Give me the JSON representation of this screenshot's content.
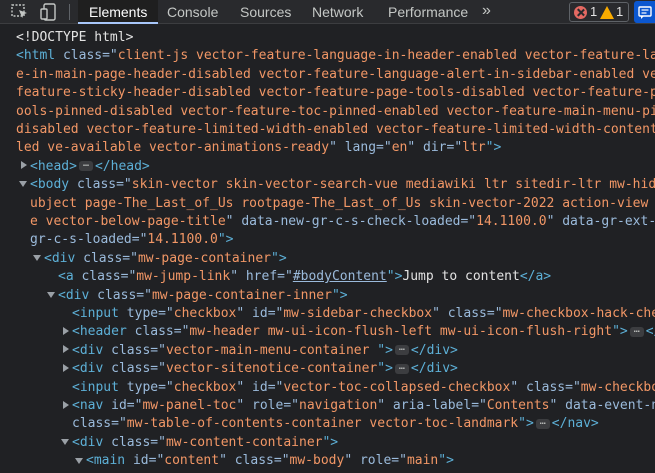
{
  "toolbar": {
    "tabs": [
      "Elements",
      "Console",
      "Sources",
      "Network",
      "Performance"
    ],
    "more_label": "»",
    "error_count": "1",
    "warning_count": "1"
  },
  "tree": {
    "doctype": "<!DOCTYPE html>",
    "html_l1a": "<html",
    "html_l1b": " class=\"",
    "html_l1c": "client-js vector-feature-language-in-header-enabled vector-feature-languag",
    "html_l2": "e-in-main-page-header-disabled vector-feature-language-alert-in-sidebar-enabled vector-",
    "html_l3": "feature-sticky-header-disabled vector-feature-page-tools-disabled vector-feature-page-t",
    "html_l4": "ools-pinned-disabled vector-feature-toc-pinned-enabled vector-feature-main-menu-pinned-",
    "html_l5": "disabled vector-feature-limited-width-enabled vector-feature-limited-width-content-enab",
    "html_l6a": "led ve-available vector-animations-ready",
    "html_l6b": "\" lang=\"",
    "html_l6c": "en",
    "html_l6d": "\" dir=\"",
    "html_l6e": "ltr",
    "html_l6f": "\">",
    "head_open": "<head>",
    "head_close": "</head>",
    "body_l1a": "<body",
    "body_l1b": " class=\"",
    "body_l1c": "skin-vector skin-vector-search-vue mediawiki ltr sitedir-ltr mw-hide-empt",
    "body_l2": "ubject page-The_Last_of_Us rootpage-The_Last_of_Us skin-vector-2022 action-view uls-di",
    "body_l3a": "e vector-below-page-title",
    "body_l3b": "\" data-new-gr-c-s-check-loaded=\"",
    "body_l3c": "14.1100.0",
    "body_l3d": "\" data-gr-ext-instal",
    "body_l4a": "gr-c-s-loaded=\"",
    "body_l4b": "14.1100.0",
    "body_l4c": "\">",
    "pc_a": "<div",
    "pc_b": " class=\"",
    "pc_c": "mw-page-container",
    "pc_d": "\">",
    "jump_a": "<a",
    "jump_b": " class=\"",
    "jump_c": "mw-jump-link",
    "jump_d": "\" href=\"",
    "jump_e": "#bodyContent",
    "jump_f": "\">",
    "jump_g": "Jump to content",
    "jump_h": "</a>",
    "pci_a": "<div",
    "pci_b": " class=\"",
    "pci_c": "mw-page-container-inner",
    "pci_d": "\">",
    "in1_a": "<input",
    "in1_b": " type=\"",
    "in1_c": "checkbox",
    "in1_d": "\" id=\"",
    "in1_e": "mw-sidebar-checkbox",
    "in1_f": "\" class=\"",
    "in1_g": "mw-checkbox-hack-checkbox",
    "hdr_a": "<header",
    "hdr_b": " class=\"",
    "hdr_c": "mw-header mw-ui-icon-flush-left mw-ui-icon-flush-right",
    "hdr_d": "\">",
    "hdr_e": "</heade",
    "mm_a": "<div",
    "mm_b": " class=\"",
    "mm_c": "vector-main-menu-container ",
    "mm_d": "\">",
    "mm_e": "</div>",
    "sn_a": "<div",
    "sn_b": " class=\"",
    "sn_c": "vector-sitenotice-container",
    "sn_d": "\">",
    "sn_e": "</div>",
    "in2_a": "<input",
    "in2_b": " type=\"",
    "in2_c": "checkbox",
    "in2_d": "\" id=\"",
    "in2_e": "vector-toc-collapsed-checkbox",
    "in2_f": "\" class=\"",
    "in2_g": "mw-checkbox-hack",
    "nav_a": "<nav",
    "nav_b": " id=\"",
    "nav_c": "mw-panel-toc",
    "nav_d": "\" role=\"",
    "nav_e": "navigation",
    "nav_f": "\" aria-label=\"",
    "nav_g": "Contents",
    "nav_h": "\" data-event-name=\"",
    "nav2_a": "class=\"",
    "nav2_b": "mw-table-of-contents-container vector-toc-landmark",
    "nav2_c": "\">",
    "nav2_d": "</nav>",
    "cc_a": "<div",
    "cc_b": " class=\"",
    "cc_c": "mw-content-container",
    "cc_d": "\">",
    "main_a": "<main",
    "main_b": " id=\"",
    "main_c": "content",
    "main_d": "\" class=\"",
    "main_e": "mw-body",
    "main_f": "\" role=\"",
    "main_g": "main",
    "main_h": "\">",
    "ellipsis": "…"
  },
  "colors": {
    "tag": "#5db0d7",
    "attr_name": "#9bbbdc",
    "attr_value": "#f29766",
    "background": "#202124"
  },
  "icons": [
    "inspect-element-icon",
    "device-toolbar-icon",
    "more-tabs-icon",
    "error-icon",
    "warning-icon",
    "messages-icon",
    "expand-arrow-icon",
    "collapse-arrow-icon"
  ]
}
